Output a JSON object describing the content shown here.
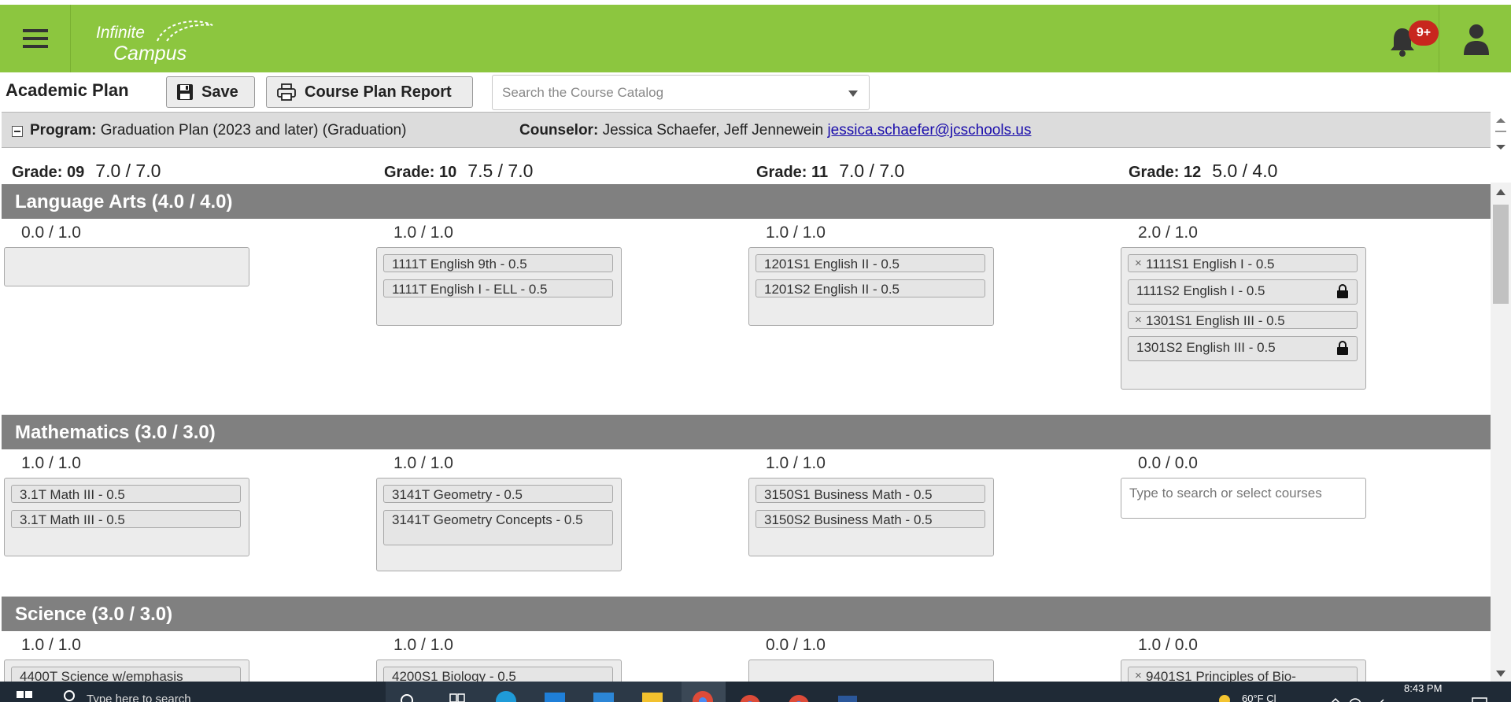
{
  "header": {
    "logo_line1": "Infinite",
    "logo_line2": "Campus",
    "notification_badge": "9+",
    "brand_color": "#8cc63f"
  },
  "toolbar": {
    "title": "Academic Plan",
    "save_label": "Save",
    "report_label": "Course Plan Report",
    "search_placeholder": "Search the Course Catalog"
  },
  "program_bar": {
    "program_label": "Program:",
    "program_value": "Graduation Plan (2023 and later) (Graduation)",
    "counselor_label": "Counselor:",
    "counselor_value": "Jessica Schaefer, Jeff Jennewein",
    "email": "jessica.schaefer@jcschools.us"
  },
  "grades": [
    {
      "label": "Grade:",
      "num": "09",
      "credits": "7.0 / 7.0"
    },
    {
      "label": "Grade:",
      "num": "10",
      "credits": "7.5 / 7.0"
    },
    {
      "label": "Grade:",
      "num": "11",
      "credits": "7.0 / 7.0"
    },
    {
      "label": "Grade:",
      "num": "12",
      "credits": "5.0 / 4.0"
    }
  ],
  "sections": [
    {
      "title": "Language Arts (4.0 / 4.0)",
      "columns": [
        {
          "credits": "0.0 / 1.0",
          "courses": []
        },
        {
          "credits": "1.0 / 1.0",
          "courses": [
            "1111T English 9th - 0.5",
            "1111T English I - ELL - 0.5"
          ]
        },
        {
          "credits": "1.0 / 1.0",
          "courses": [
            "1201S1 English II - 0.5",
            "1201S2 English II - 0.5"
          ]
        },
        {
          "credits": "2.0 / 1.0",
          "courses": [
            "1111S1 English I - 0.5",
            "1111S2 English I - 0.5",
            "1301S1 English III - 0.5",
            "1301S2 English III - 0.5"
          ]
        }
      ]
    },
    {
      "title": "Mathematics (3.0 / 3.0)",
      "columns": [
        {
          "credits": "1.0 / 1.0",
          "courses": [
            "3.1T Math III - 0.5",
            "3.1T Math III - 0.5"
          ]
        },
        {
          "credits": "1.0 / 1.0",
          "courses": [
            "3141T Geometry - 0.5",
            "3141T Geometry Concepts - 0.5"
          ]
        },
        {
          "credits": "1.0 / 1.0",
          "courses": [
            "3150S1 Business Math - 0.5",
            "3150S2 Business Math - 0.5"
          ]
        },
        {
          "credits": "0.0 / 0.0",
          "placeholder": "Type to search or select courses"
        }
      ]
    },
    {
      "title": "Science (3.0 / 3.0)",
      "columns": [
        {
          "credits": "1.0 / 1.0",
          "courses": [
            "4400T Science w/emphasis"
          ]
        },
        {
          "credits": "1.0 / 1.0",
          "courses": [
            "4200S1 Biology - 0.5"
          ]
        },
        {
          "credits": "0.0 / 1.0",
          "courses": []
        },
        {
          "credits": "1.0 / 0.0",
          "courses": [
            "9401S1 Principles of Bio-"
          ]
        }
      ]
    }
  ],
  "taskbar": {
    "search_placeholder": "Type here to search",
    "weather": "60°F  Cl",
    "time": "8:43 PM"
  }
}
